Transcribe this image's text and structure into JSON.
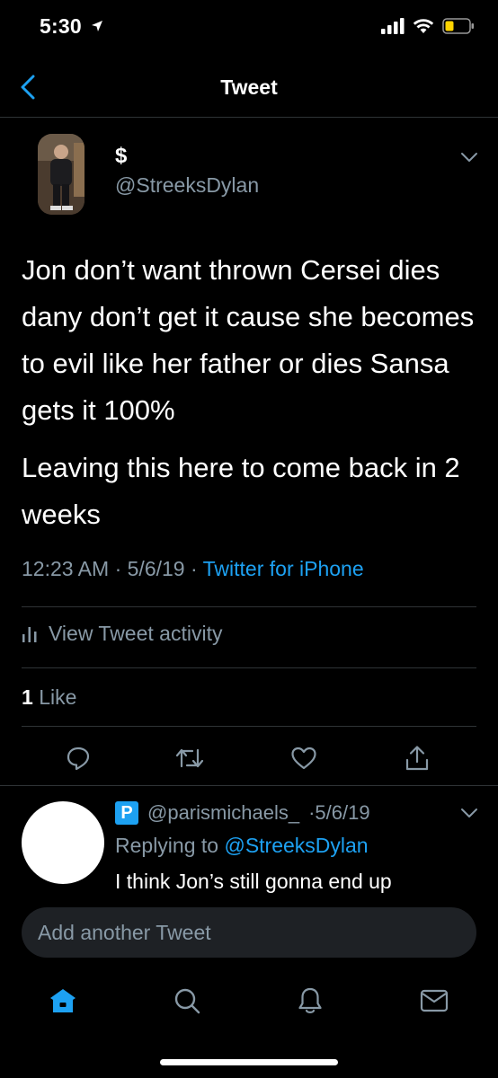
{
  "status_bar": {
    "time": "5:30"
  },
  "nav": {
    "title": "Tweet"
  },
  "tweet": {
    "display_name": "$",
    "handle": "@StreeksDylan",
    "paragraphs": [
      "Jon don’t want thrown Cersei dies dany don’t get it cause she becomes to evil like her father or dies Sansa gets it 100%",
      "Leaving this here to come back in 2 weeks"
    ],
    "time": "12:23 AM",
    "date": "5/6/19",
    "separator": "·",
    "source": "Twitter for iPhone"
  },
  "activity": {
    "label": "View Tweet activity"
  },
  "likes": {
    "count": "1",
    "label": "Like"
  },
  "actions": [
    "reply-icon",
    "retweet-icon",
    "like-icon",
    "share-icon"
  ],
  "reply": {
    "badge": "P",
    "handle": "@parismichaels_",
    "date": "·5/6/19",
    "replying_to_prefix": "Replying to",
    "replying_to_handle": "@StreeksDylan",
    "text": "I think Jon’s still gonna end up"
  },
  "compose": {
    "placeholder": "Add another Tweet"
  },
  "tabbar": [
    "home-icon",
    "search-icon",
    "notifications-icon",
    "messages-icon"
  ],
  "colors": {
    "background": "#000000",
    "accent": "#1da1f2",
    "secondary_text": "#8899a6",
    "divider": "#2f3336",
    "battery": "#ffd400"
  }
}
